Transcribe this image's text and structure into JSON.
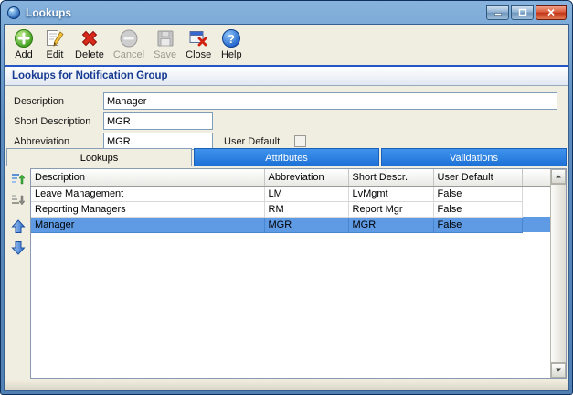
{
  "window": {
    "title": "Lookups"
  },
  "toolbar": {
    "buttons": [
      {
        "label": "Add",
        "icon": "add-icon",
        "enabled": true
      },
      {
        "label": "Edit",
        "icon": "edit-icon",
        "enabled": true
      },
      {
        "label": "Delete",
        "icon": "delete-icon",
        "enabled": true
      },
      {
        "label": "Cancel",
        "icon": "cancel-icon",
        "enabled": false
      },
      {
        "label": "Save",
        "icon": "save-icon",
        "enabled": false
      },
      {
        "label": "Close",
        "icon": "close-window-icon",
        "enabled": true
      },
      {
        "label": "Help",
        "icon": "help-icon",
        "enabled": true
      }
    ]
  },
  "header": {
    "title": "Lookups for Notification Group"
  },
  "form": {
    "description": {
      "label": "Description",
      "value": "Manager"
    },
    "short_description": {
      "label": "Short Description",
      "value": "MGR"
    },
    "abbreviation": {
      "label": "Abbreviation",
      "value": "MGR"
    },
    "user_default": {
      "label": "User Default",
      "checked": false
    }
  },
  "tabs": [
    {
      "label": "Lookups",
      "active": true
    },
    {
      "label": "Attributes",
      "active": false
    },
    {
      "label": "Validations",
      "active": false
    }
  ],
  "grid": {
    "columns": [
      "Description",
      "Abbreviation",
      "Short Descr.",
      "User Default"
    ],
    "rows": [
      [
        "Leave Management",
        "LM",
        "LvMgmt",
        "False"
      ],
      [
        "Reporting Managers",
        "RM",
        "Report Mgr",
        "False"
      ],
      [
        "Manager",
        "MGR",
        "MGR",
        "False"
      ]
    ],
    "selected_row": 2
  },
  "colors": {
    "tab_blue": "#2a7fd8",
    "selection_blue": "#5f9be5",
    "header_text_blue": "#183c93",
    "frame_blue": "#4f7fb3"
  }
}
